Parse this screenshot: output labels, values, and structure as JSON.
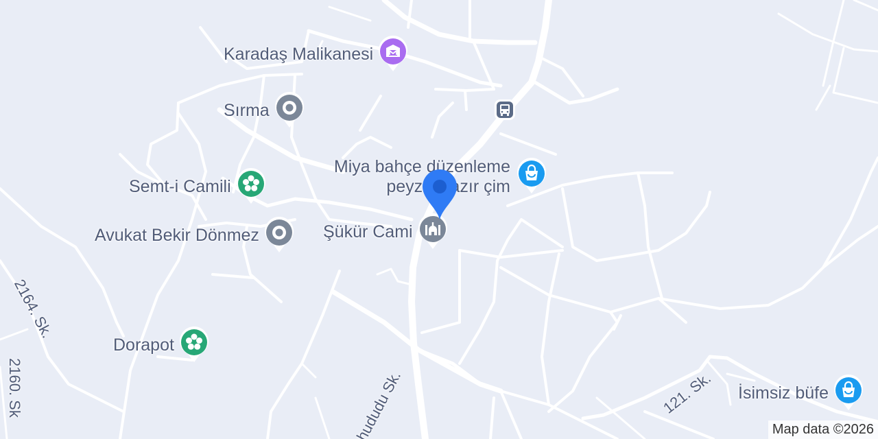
{
  "map": {
    "pois": {
      "karadas": {
        "label": "Karadaş Malikanesi",
        "icon": "building-icon",
        "color": "#a96cf0"
      },
      "sirma": {
        "label": "Sırma",
        "icon": "place-dot-icon",
        "color": "#7b8798"
      },
      "semt": {
        "label": "Semt-i Camili",
        "icon": "flower-icon",
        "color": "#27a776"
      },
      "avukat": {
        "label": "Avukat Bekir Dönmez",
        "icon": "place-dot-icon",
        "color": "#7b8798"
      },
      "sukur": {
        "label": "Şükür Cami",
        "icon": "mosque-icon",
        "color": "#7b8798"
      },
      "miya": {
        "label_line1": "Miya bahçe düzenleme",
        "label_line2": "peyzaj hazır çim",
        "icon": "shopping-bag-icon",
        "color": "#1a9bf0"
      },
      "dorapot": {
        "label": "Dorapot",
        "icon": "flower-icon",
        "color": "#27a776"
      },
      "isimsiz": {
        "label": "İsimsiz büfe",
        "icon": "shopping-bag-icon",
        "color": "#1a9bf0"
      },
      "bus": {
        "icon": "bus-stop-icon",
        "color": "#5b6b87"
      }
    },
    "streets": {
      "s2164": "2164. Sk.",
      "s2160": "2160. Sk",
      "ahududu": "Ahududu Sk.",
      "s121": "121. Sk."
    },
    "marker": {
      "icon": "location-pin-icon",
      "color": "#2f7bf5"
    },
    "attribution": "Map data ©2026"
  }
}
